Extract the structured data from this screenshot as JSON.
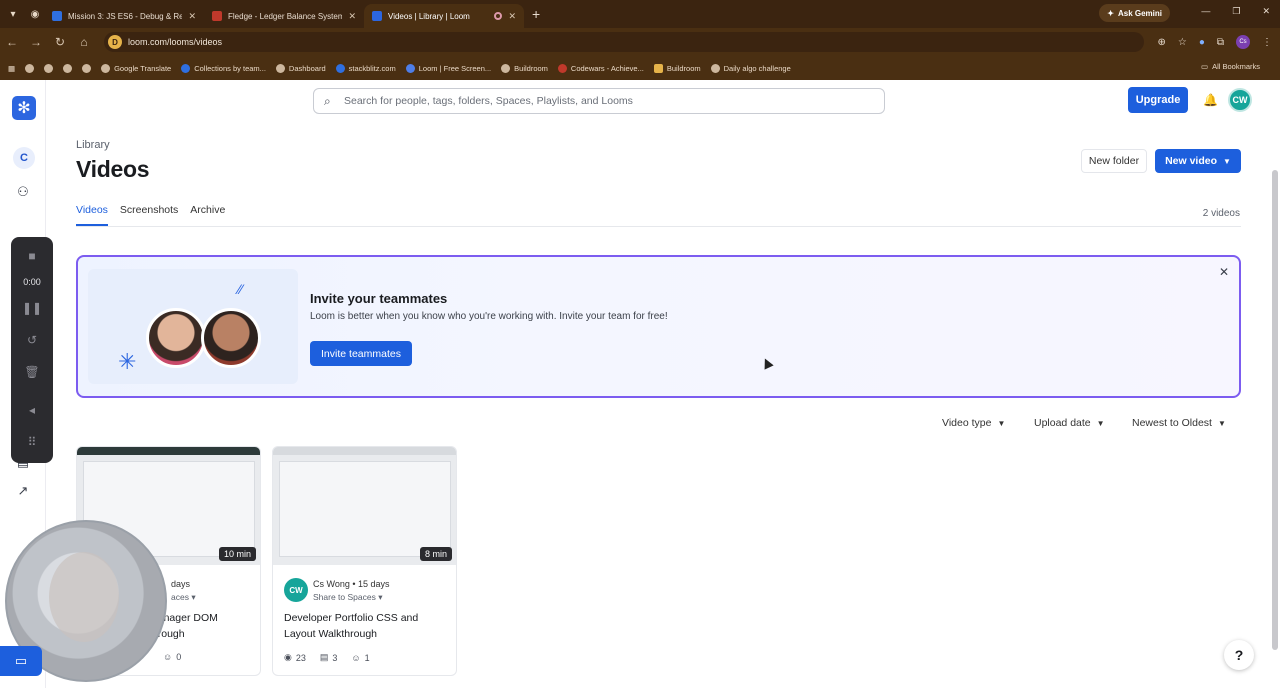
{
  "browser": {
    "tabs": [
      {
        "title": "Mission 3: JS ES6 - Debug & Re",
        "favicon_color": "#2f6fe0"
      },
      {
        "title": "Fledge - Ledger Balance System",
        "favicon_color": "#c0392b"
      },
      {
        "title": "Videos | Library | Loom",
        "favicon_color": "#2c66e0",
        "active": true
      }
    ],
    "new_tab_label": "+",
    "gemini_label": "Ask Gemini",
    "url": "loom.com/looms/videos",
    "site_badge": "D",
    "profile_badge": "Cs",
    "bookmarks": [
      {
        "label": ""
      },
      {
        "label": ""
      },
      {
        "label": ""
      },
      {
        "label": ""
      },
      {
        "label": "Google Translate"
      },
      {
        "label": "Collections by team..."
      },
      {
        "label": "Dashboard"
      },
      {
        "label": "stackblitz.com"
      },
      {
        "label": "Loom | Free Screen..."
      },
      {
        "label": "Buildroom"
      },
      {
        "label": "Codewars - Achieve..."
      },
      {
        "label": "Buildroom"
      },
      {
        "label": "Daily algo challenge"
      }
    ],
    "all_bookmarks_label": "All Bookmarks"
  },
  "nav": {
    "workspace_initial": "C"
  },
  "recorder": {
    "time": "0:00"
  },
  "search": {
    "placeholder": "Search for people, tags, folders, Spaces, Playlists, and Looms"
  },
  "header": {
    "upgrade_label": "Upgrade",
    "avatar_initials": "CW"
  },
  "page": {
    "breadcrumb": "Library",
    "title": "Videos",
    "new_folder_label": "New folder",
    "new_video_label": "New video",
    "tabs": [
      "Videos",
      "Screenshots",
      "Archive"
    ],
    "count": "2 videos"
  },
  "banner": {
    "heading": "Invite your teammates",
    "body": "Loom is better when you know who you're working with. Invite your team for free!",
    "button": "Invite teammates"
  },
  "filters": {
    "video_type": "Video type",
    "upload_date": "Upload date",
    "sort": "Newest to Oldest"
  },
  "videos": [
    {
      "duration": "10 min",
      "author": "",
      "age": "days",
      "share": "aces",
      "title": "Manager DOM\nthrough",
      "views": "",
      "comments": "",
      "reactions": "0"
    },
    {
      "duration": "8 min",
      "author_initials": "CW",
      "author": "Cs Wong",
      "age": "15 days",
      "share": "Share to Spaces",
      "title": "Developer Portfolio CSS and Layout Walkthrough",
      "views": "23",
      "comments": "3",
      "reactions": "1"
    }
  ],
  "help_label": "?"
}
